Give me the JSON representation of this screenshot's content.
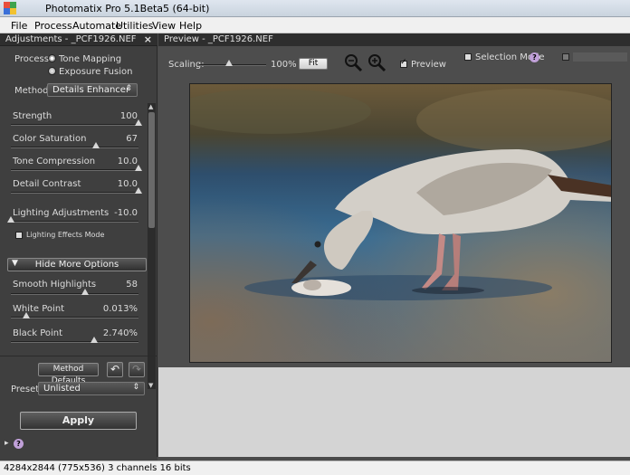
{
  "window": {
    "title": "Photomatix Pro 5.1Beta5 (64-bit)"
  },
  "menu": [
    "File",
    "Process",
    "Automate",
    "Utilities",
    "View",
    "Help"
  ],
  "adjustments": {
    "panel_title": "Adjustments - _PCF1926.NEF",
    "close_glyph": "×",
    "process_label": "Process:",
    "process_options": [
      "Tone Mapping",
      "Exposure Fusion"
    ],
    "process_selected": "Tone Mapping",
    "method_label": "Method:",
    "method_value": "Details Enhancer",
    "sliders": [
      {
        "label": "Strength",
        "value": "100",
        "fraction": 1.0
      },
      {
        "label": "Color Saturation",
        "value": "67",
        "fraction": 0.67
      },
      {
        "label": "Tone Compression",
        "value": "10.0",
        "fraction": 1.0
      },
      {
        "label": "Detail Contrast",
        "value": "10.0",
        "fraction": 1.0
      },
      {
        "label": "Lighting Adjustments",
        "value": "-10.0",
        "fraction": 0.0
      }
    ],
    "lighting_effects_label": "Lighting Effects Mode",
    "lighting_effects_checked": false,
    "hide_more_label": "Hide More Options",
    "more_sliders": [
      {
        "label": "Smooth Highlights",
        "value": "58",
        "fraction": 0.58
      },
      {
        "label": "White Point",
        "value": "0.013%",
        "fraction": 0.12
      },
      {
        "label": "Black Point",
        "value": "2.740%",
        "fraction": 0.65
      }
    ],
    "method_defaults_label": "Method Defaults",
    "undo_glyph": "↶",
    "redo_glyph": "↷",
    "preset_label": "Preset:",
    "preset_value": "Unlisted",
    "apply_label": "Apply",
    "expand_glyph": "▸",
    "help_glyph": "?"
  },
  "preview": {
    "panel_title": "Preview - _PCF1926.NEF",
    "scaling_label": "Scaling:",
    "scaling_value": "100%",
    "scaling_fraction": 0.45,
    "fit_label": "Fit",
    "preview_label": "Preview",
    "preview_checked": true,
    "selection_mode_label": "Selection Mode",
    "selection_mode_checked": false,
    "help_glyph": "?"
  },
  "status": {
    "text": "4284x2844 (775x536) 3 channels 16 bits"
  },
  "colors": {
    "panel": "#3f3f3f",
    "header": "#2e2e2e",
    "help": "#c0a0d8"
  }
}
